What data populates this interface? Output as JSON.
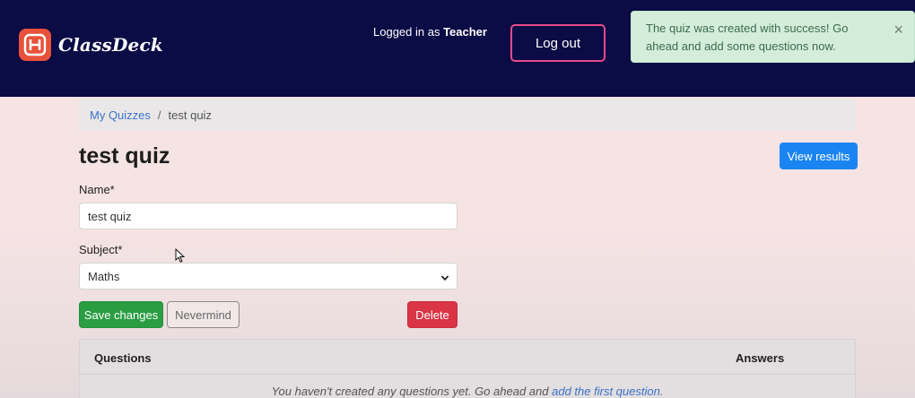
{
  "header": {
    "brand": "ClassDeck",
    "logged_in_prefix": "Logged in as",
    "logged_in_user": "Teacher",
    "logout_label": "Log out"
  },
  "alert": {
    "message": "The quiz was created with success! Go ahead and add some questions now.",
    "close": "×"
  },
  "breadcrumb": {
    "parent": "My Quizzes",
    "separator": "/",
    "current": "test quiz"
  },
  "page": {
    "title": "test quiz",
    "view_results_label": "View results"
  },
  "form": {
    "name_label": "Name*",
    "name_value": "test quiz",
    "subject_label": "Subject*",
    "subject_value": "Maths",
    "save_label": "Save changes",
    "nevermind_label": "Nevermind",
    "delete_label": "Delete"
  },
  "table": {
    "col_questions": "Questions",
    "col_answers": "Answers",
    "empty_prefix": "You haven't created any questions yet. Go ahead and",
    "empty_link": "add the first question."
  },
  "colors": {
    "navbar": "#0b0b45",
    "brand_accent": "#e8523a",
    "logout_border": "#e94b8a",
    "alert_bg": "#d4eddb",
    "primary": "#1a85f2",
    "success": "#2a9d43",
    "danger": "#d93545"
  },
  "icons": {
    "brand": "classdeck-logo-icon",
    "alert_close": "close-icon",
    "select": "chevron-down-icon",
    "cursor": "mouse-pointer-icon"
  }
}
